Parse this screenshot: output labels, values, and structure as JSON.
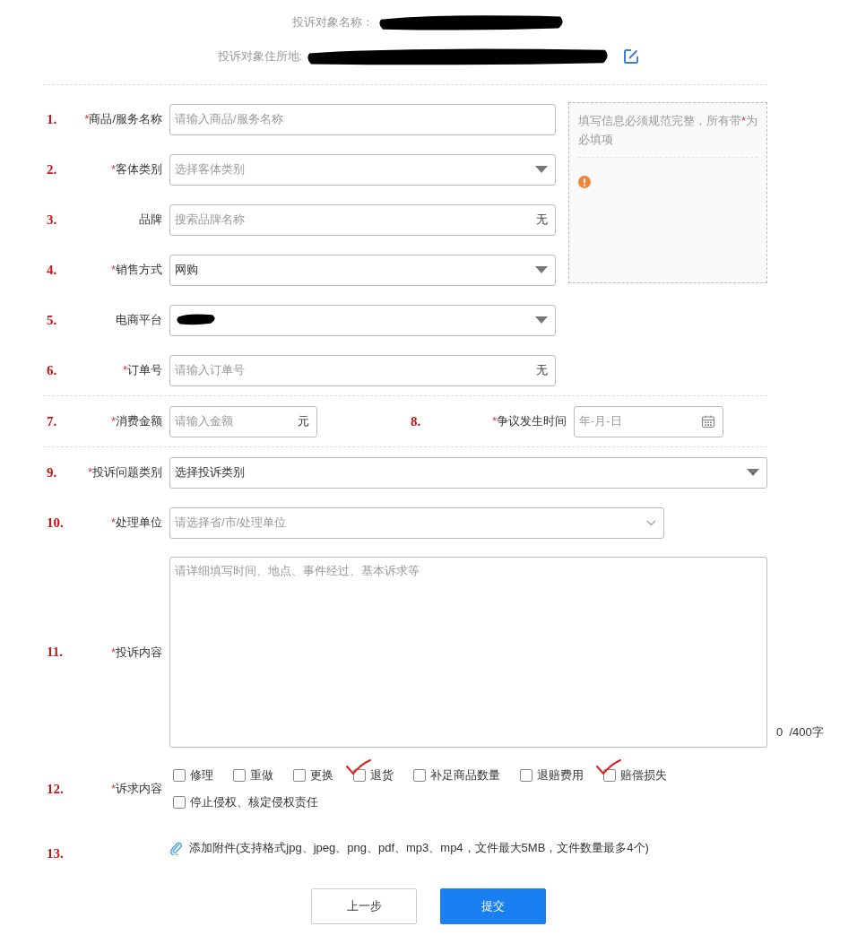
{
  "required_mark": "*",
  "complaint_target": [
    {
      "label": "投诉对象名称：",
      "redacted": true,
      "editable": false
    },
    {
      "label": "投诉对象住所地:",
      "redacted": true,
      "editable": true
    }
  ],
  "product_section": {
    "fields": [
      {
        "number": "1.",
        "label": "商品/服务名称",
        "required": true,
        "kind": "text",
        "placeholder": "请输入商品/服务名称"
      },
      {
        "number": "2.",
        "label": "客体类别",
        "required": true,
        "kind": "select",
        "placeholder": "选择客体类别"
      },
      {
        "number": "3.",
        "label": "品牌",
        "required": false,
        "kind": "text",
        "placeholder": "搜索品牌名称",
        "suffix": "无"
      },
      {
        "number": "4.",
        "label": "销售方式",
        "required": true,
        "kind": "select",
        "value": "网购"
      },
      {
        "number": "5.",
        "label": "电商平台",
        "required": false,
        "kind": "select",
        "redacted": true
      },
      {
        "number": "6.",
        "label": "订单号",
        "required": true,
        "kind": "text",
        "placeholder": "请输入订单号",
        "suffix": "无"
      }
    ],
    "hint": {
      "text_before": "填写信息必须规范完整，所有带",
      "mark": "*",
      "text_after": "为必填项",
      "warning": true
    }
  },
  "amount_row": [
    {
      "number": "7.",
      "label": "消费金额",
      "required": true,
      "kind": "text",
      "placeholder": "请输入金额",
      "suffix": "元"
    },
    {
      "number": "8.",
      "label": "争议发生时间",
      "required": true,
      "kind": "date",
      "placeholder": "年-月-日"
    }
  ],
  "complaint_fields": [
    {
      "number": "9.",
      "label": "投诉问题类别",
      "required": true,
      "kind": "select",
      "value": "选择投诉类别"
    },
    {
      "number": "10.",
      "label": "处理单位",
      "required": true,
      "kind": "cascader",
      "placeholder": "请选择省/市/处理单位"
    },
    {
      "number": "11.",
      "label": "投诉内容",
      "required": true,
      "kind": "textarea",
      "placeholder": "请详细填写时间、地点、事件经过、基本诉求等",
      "counter": "0  /400字"
    }
  ],
  "demands": {
    "number": "12.",
    "label": "诉求内容",
    "required": true,
    "options": [
      {
        "label": "修理",
        "ticked": false
      },
      {
        "label": "重做",
        "ticked": false
      },
      {
        "label": "更换",
        "ticked": false
      },
      {
        "label": "退货",
        "ticked": true
      },
      {
        "label": "补足商品数量",
        "ticked": false
      },
      {
        "label": "退赔费用",
        "ticked": false
      },
      {
        "label": "赔偿损失",
        "ticked": true
      },
      {
        "label": "停止侵权、核定侵权责任",
        "ticked": false
      }
    ]
  },
  "attachment": {
    "number": "13.",
    "text": "添加附件(支持格式jpg、jpeg、png、pdf、mp3、mp4，文件最大5MB，文件数量最多4个)"
  },
  "buttons": [
    {
      "label": "上一步",
      "kind": "secondary"
    },
    {
      "label": "提交",
      "kind": "primary"
    }
  ]
}
